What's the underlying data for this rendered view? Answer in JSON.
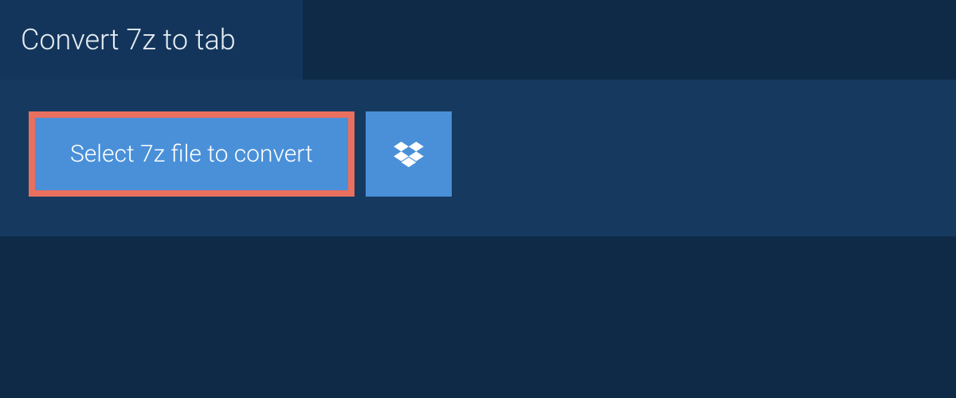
{
  "header": {
    "title": "Convert 7z to tab"
  },
  "actions": {
    "select_file_label": "Select 7z file to convert",
    "dropbox_icon": "dropbox-icon"
  },
  "colors": {
    "background": "#0e2a47",
    "panel": "#163a5f",
    "tab": "#14355b",
    "button": "#4a90d9",
    "highlight_border": "#e96f5f",
    "text_light": "#ffffff"
  }
}
